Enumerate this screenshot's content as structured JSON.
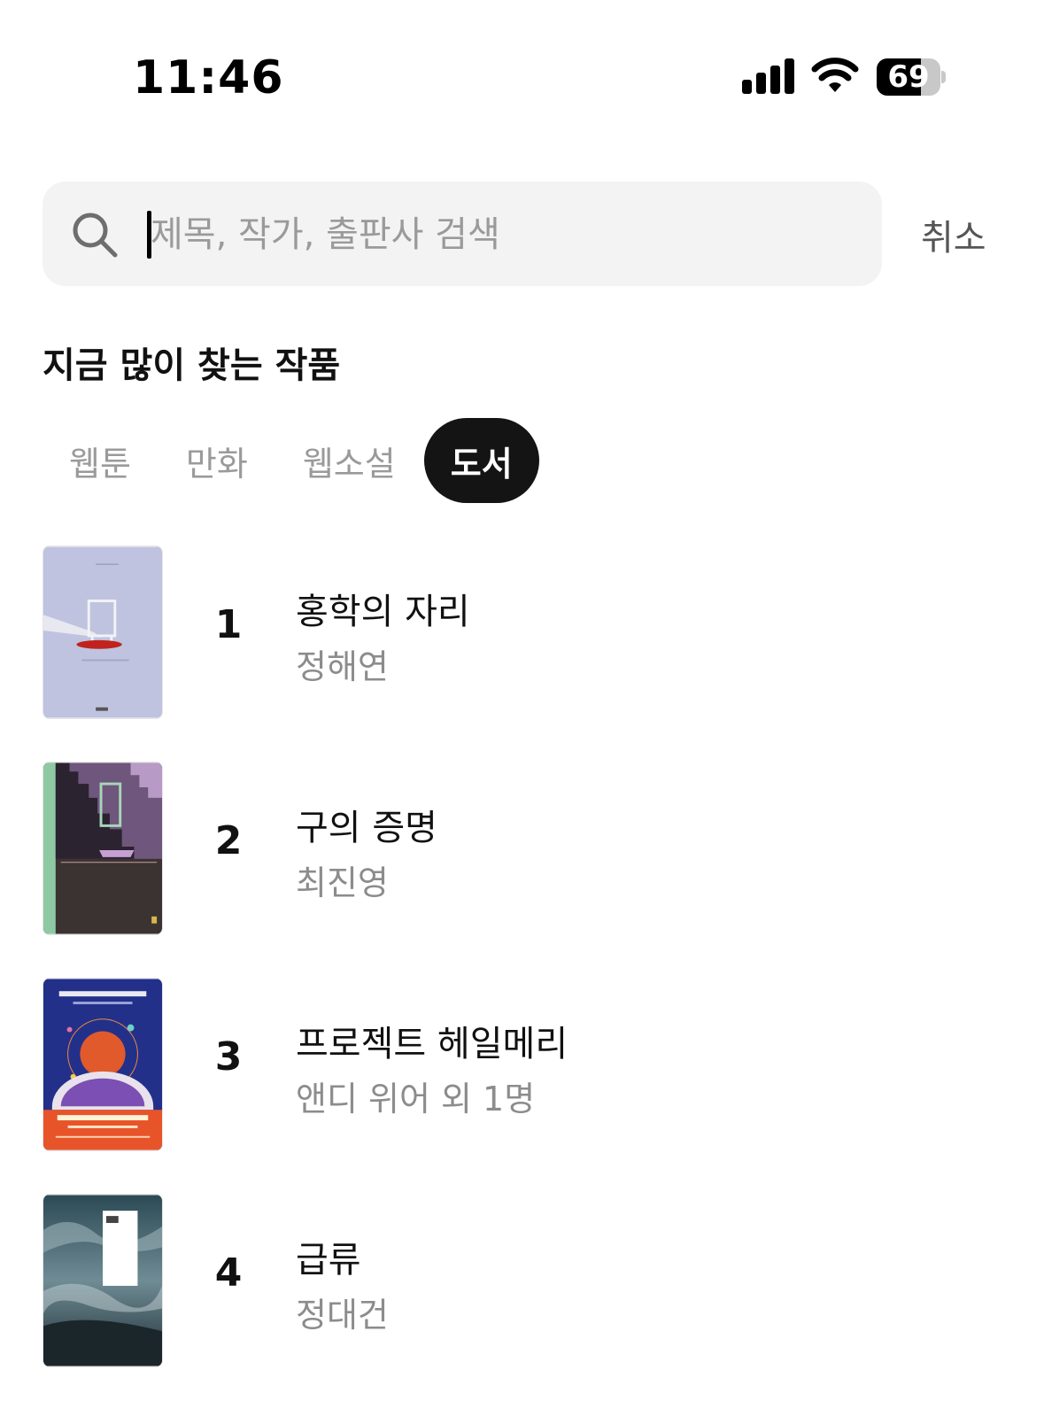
{
  "status_bar": {
    "time": "11:46",
    "battery": 69,
    "battery_label": "69",
    "icons": [
      "signal-icon",
      "wifi-icon",
      "battery-icon"
    ]
  },
  "search": {
    "placeholder": "제목, 작가, 출판사 검색",
    "value": "",
    "cancel_label": "취소"
  },
  "section": {
    "title": "지금 많이 찾는 작품"
  },
  "tabs": [
    {
      "label": "웹툰",
      "active": false
    },
    {
      "label": "만화",
      "active": false
    },
    {
      "label": "웹소설",
      "active": false
    },
    {
      "label": "도서",
      "active": true
    }
  ],
  "books": [
    {
      "rank": "1",
      "title": "홍학의 자리",
      "author": "정해연"
    },
    {
      "rank": "2",
      "title": "구의 증명",
      "author": "최진영"
    },
    {
      "rank": "3",
      "title": "프로젝트 헤일메리",
      "author": "앤디 위어 외 1명"
    },
    {
      "rank": "4",
      "title": "급류",
      "author": "정대건"
    }
  ],
  "colors": {
    "active_tab_bg": "#141414",
    "search_bg": "#f3f3f3",
    "muted_text": "#9a9a9a"
  }
}
